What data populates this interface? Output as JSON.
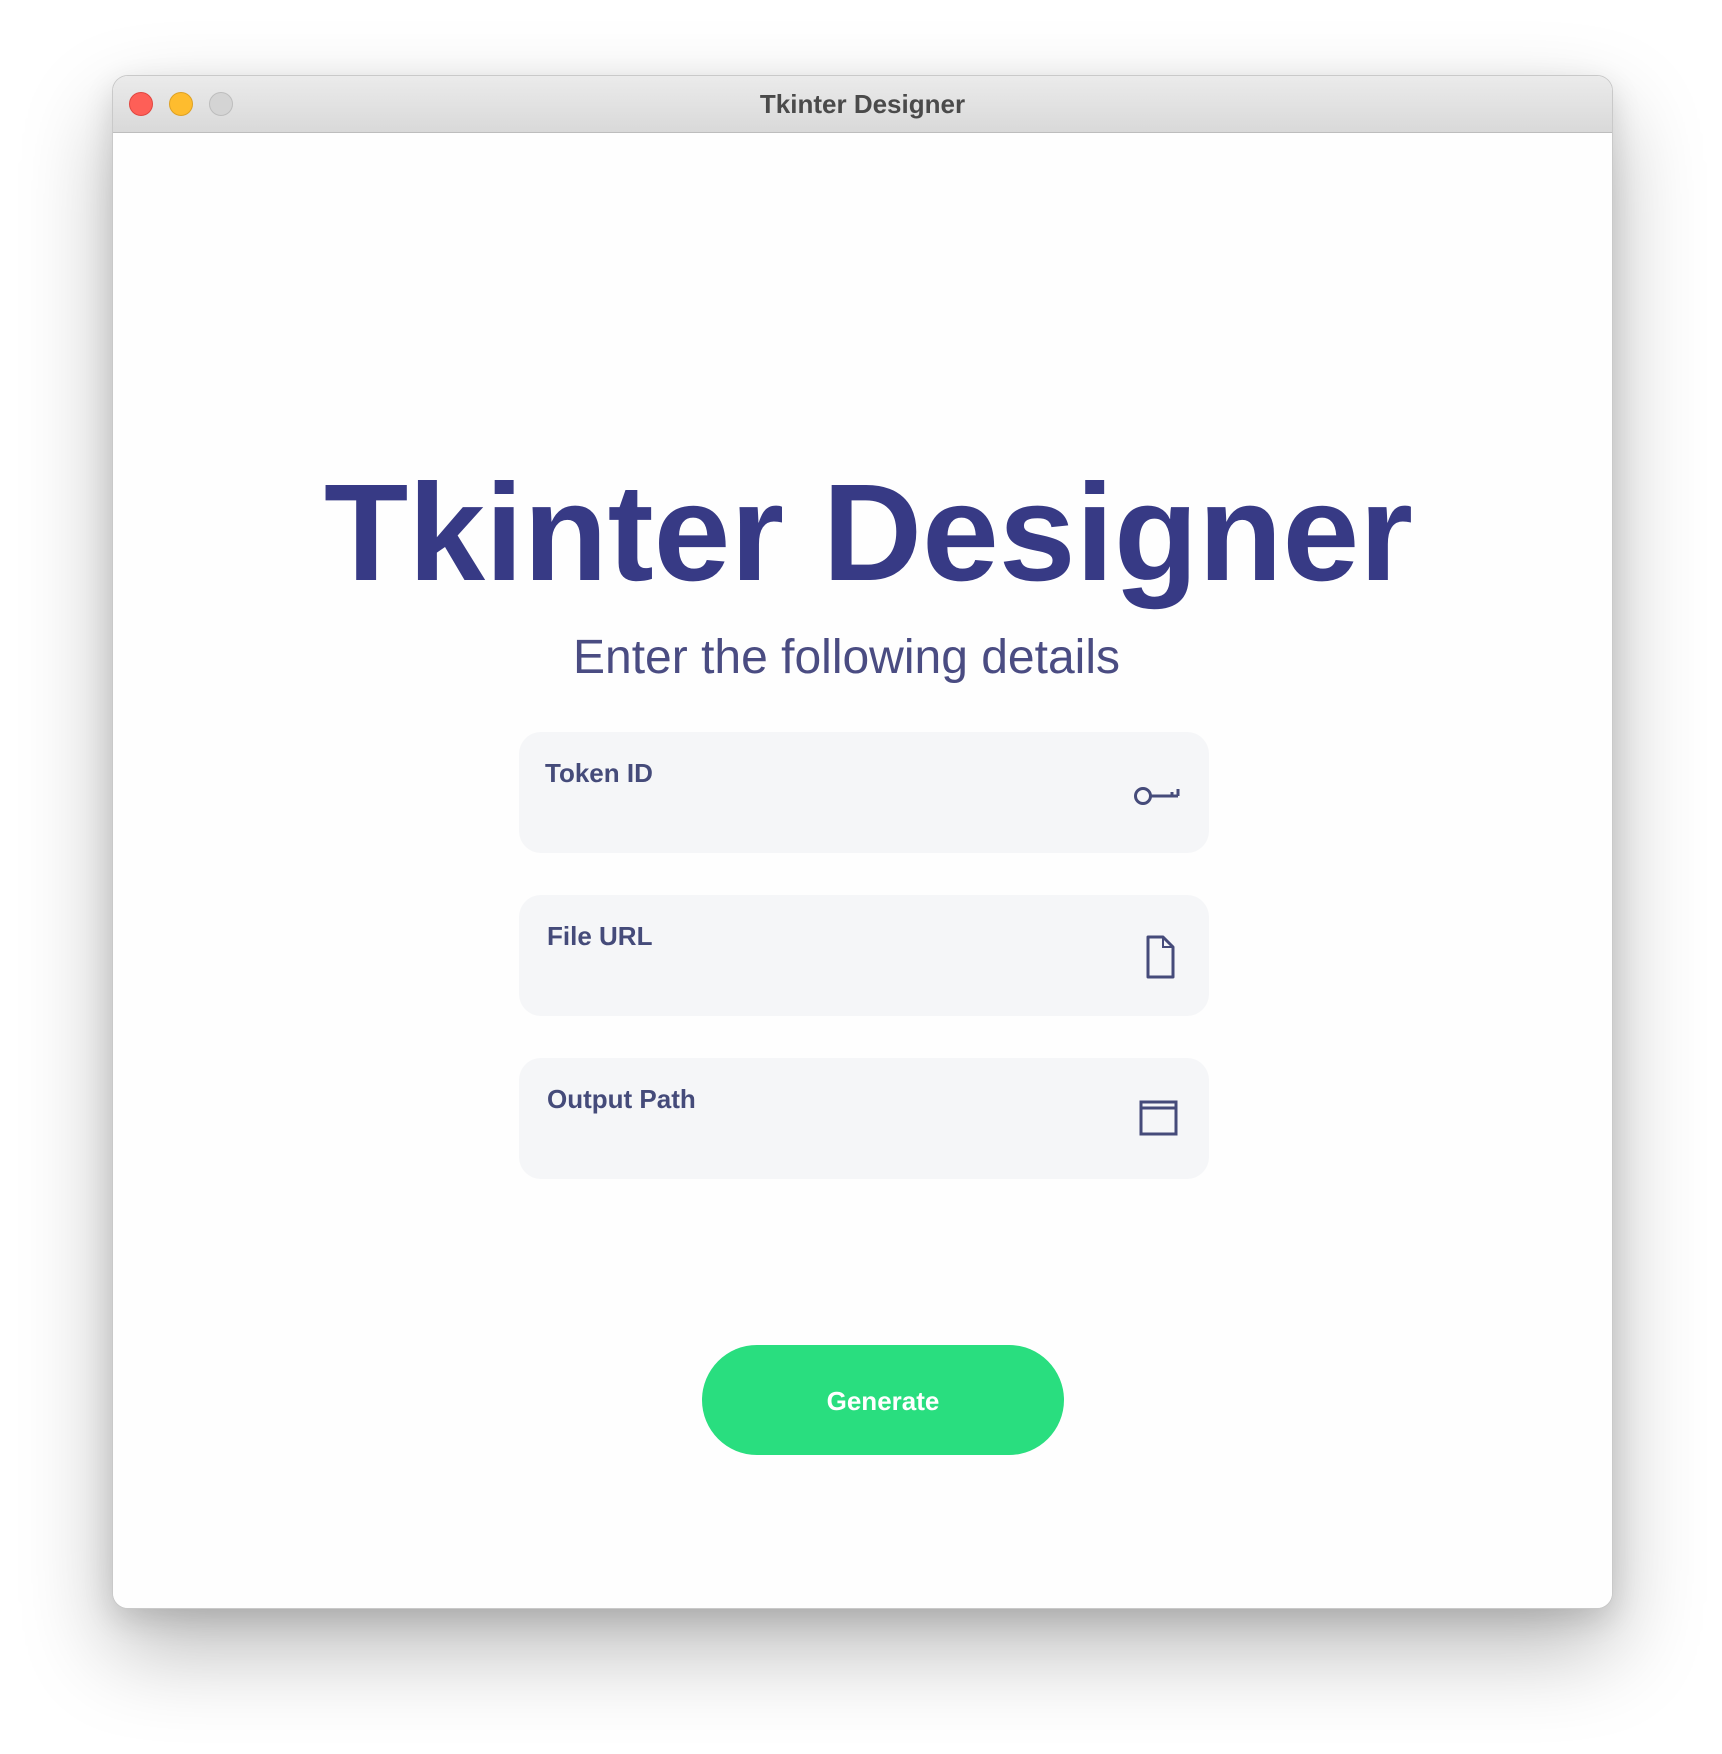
{
  "window": {
    "title": "Tkinter Designer",
    "controls": [
      "close",
      "minimize",
      "zoom"
    ]
  },
  "main": {
    "heading": "Tkinter Designer",
    "subheading": "Enter the following details"
  },
  "fields": [
    {
      "label": "Token ID",
      "value": "",
      "icon": "key-icon"
    },
    {
      "label": "File URL",
      "value": "",
      "icon": "file-icon"
    },
    {
      "label": "Output Path",
      "value": "",
      "icon": "folder-icon"
    }
  ],
  "actions": {
    "generate_label": "Generate"
  },
  "colors": {
    "heading": "#373a85",
    "subheading": "#4a4c82",
    "field_label": "#454b7a",
    "field_bg": "#f5f6f8",
    "button_bg": "#29de7f",
    "button_text": "#ffffff"
  }
}
